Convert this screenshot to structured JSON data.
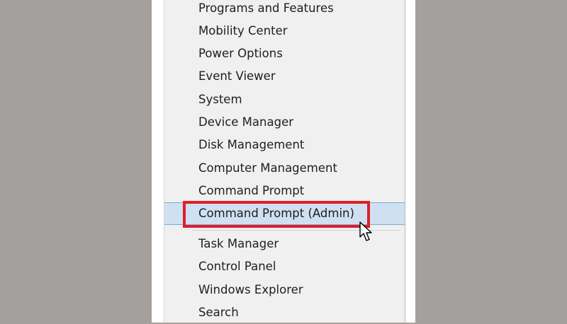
{
  "menu": {
    "items": [
      {
        "label": "Programs and Features"
      },
      {
        "label": "Mobility Center"
      },
      {
        "label": "Power Options"
      },
      {
        "label": "Event Viewer"
      },
      {
        "label": "System"
      },
      {
        "label": "Device Manager"
      },
      {
        "label": "Disk Management"
      },
      {
        "label": "Computer Management"
      },
      {
        "label": "Command Prompt"
      },
      {
        "label": "Command Prompt (Admin)"
      },
      {
        "label": "Task Manager"
      },
      {
        "label": "Control Panel"
      },
      {
        "label": "Windows Explorer"
      },
      {
        "label": "Search"
      }
    ],
    "selected": "Command Prompt (Admin)"
  },
  "colors": {
    "backdrop": "#a4a09e",
    "menu_background": "#f0f0f0",
    "highlight": "#cfe0f3",
    "highlight_border": "#7fa9d6",
    "callout": "#e01e26"
  },
  "icons": {
    "pointer": "mouse-pointer-icon"
  }
}
